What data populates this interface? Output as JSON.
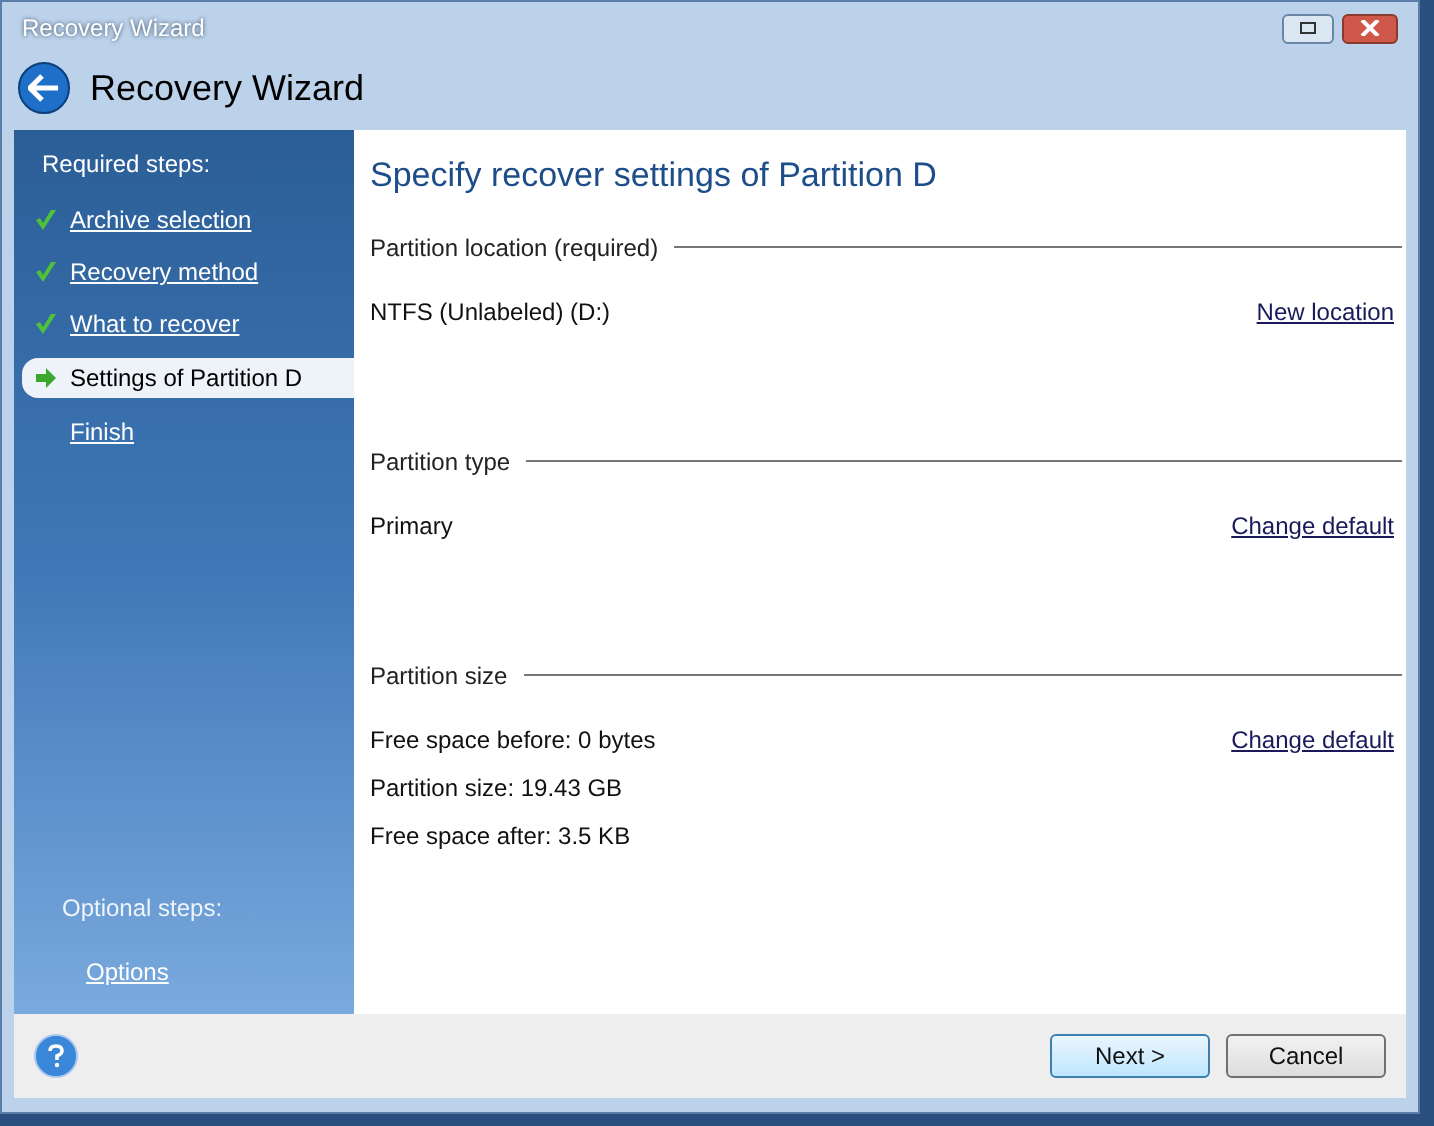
{
  "window": {
    "title": "Recovery Wizard"
  },
  "header": {
    "title": "Recovery Wizard"
  },
  "sidebar": {
    "required_label": "Required steps:",
    "steps": [
      {
        "label": "Archive selection",
        "kind": "done",
        "selected": false
      },
      {
        "label": "Recovery method",
        "kind": "done",
        "selected": false
      },
      {
        "label": "What to recover",
        "kind": "done",
        "selected": false
      },
      {
        "label": "Settings of Partition D",
        "kind": "current",
        "selected": true
      },
      {
        "label": "Finish",
        "kind": "pending",
        "selected": false
      }
    ],
    "optional_label": "Optional steps:",
    "optional_steps": [
      {
        "label": "Options"
      }
    ]
  },
  "content": {
    "title": "Specify recover settings of Partition D",
    "sections": [
      {
        "label": "Partition location (required)",
        "lines": [
          "NTFS (Unlabeled) (D:)"
        ],
        "link": "New location"
      },
      {
        "label": "Partition type",
        "lines": [
          "Primary"
        ],
        "link": "Change default"
      },
      {
        "label": "Partition size",
        "lines": [
          "Free space before: 0 bytes",
          "Partition size: 19.43 GB",
          "Free space after: 3.5 KB"
        ],
        "link": "Change default"
      }
    ]
  },
  "buttons": [
    {
      "label": "Next >",
      "kind": "primary"
    },
    {
      "label": "Cancel",
      "kind": "normal"
    }
  ]
}
